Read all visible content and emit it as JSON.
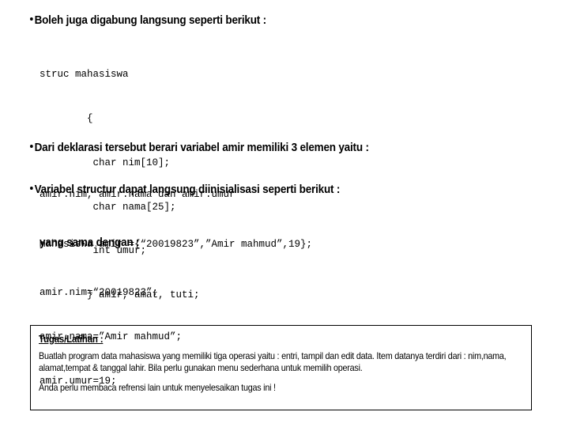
{
  "slide": {
    "bullet_glyph": "•",
    "headings": [
      {
        "id": "heading-boleh",
        "text": "Boleh juga digabung langsung seperti berikut :"
      },
      {
        "id": "heading-dari-deklarasi",
        "text": "Dari deklarasi tersebut berari variabel amir memiliki 3 elemen yaitu :"
      },
      {
        "id": "heading-variabel-structur",
        "text": "Variabel structur dapat langsung diinisialisasi seperti berikut :"
      }
    ],
    "subheading": "yang sama dengan :",
    "code_struct": {
      "line1": "struc mahasiswa",
      "line2": "        {",
      "line3": "         char nim[10];",
      "line4": "         char nama[25];",
      "line5": "         int umur;",
      "line6": "        } amir, amat, tuti;"
    },
    "code_elements": "amir.nim, amir.nama dan amir.umur",
    "code_init": "mahasiswa amir ={“20019823”,”Amir mahmud”,19};",
    "code_assign": {
      "line1": "amir.nim=“20019823”;",
      "line2": "amir.nama=”Amir mahmud”;",
      "line3": "amir.umur=19;"
    },
    "task_box": {
      "title": "Tugas/Latihan :",
      "paragraph1": "Buatlah program data mahasiswa yang memiliki tiga operasi yaitu : entri, tampil dan edit data. Item datanya terdiri dari  : nim,nama, alamat,tempat & tanggal lahir. Bila perlu gunakan menu sederhana untuk memilih operasi.",
      "paragraph2": "Anda perlu membaca refrensi lain untuk menyelesaikan tugas ini !"
    },
    "colors": {
      "text": "#000000",
      "background": "#ffffff",
      "box_border": "#000000"
    }
  }
}
